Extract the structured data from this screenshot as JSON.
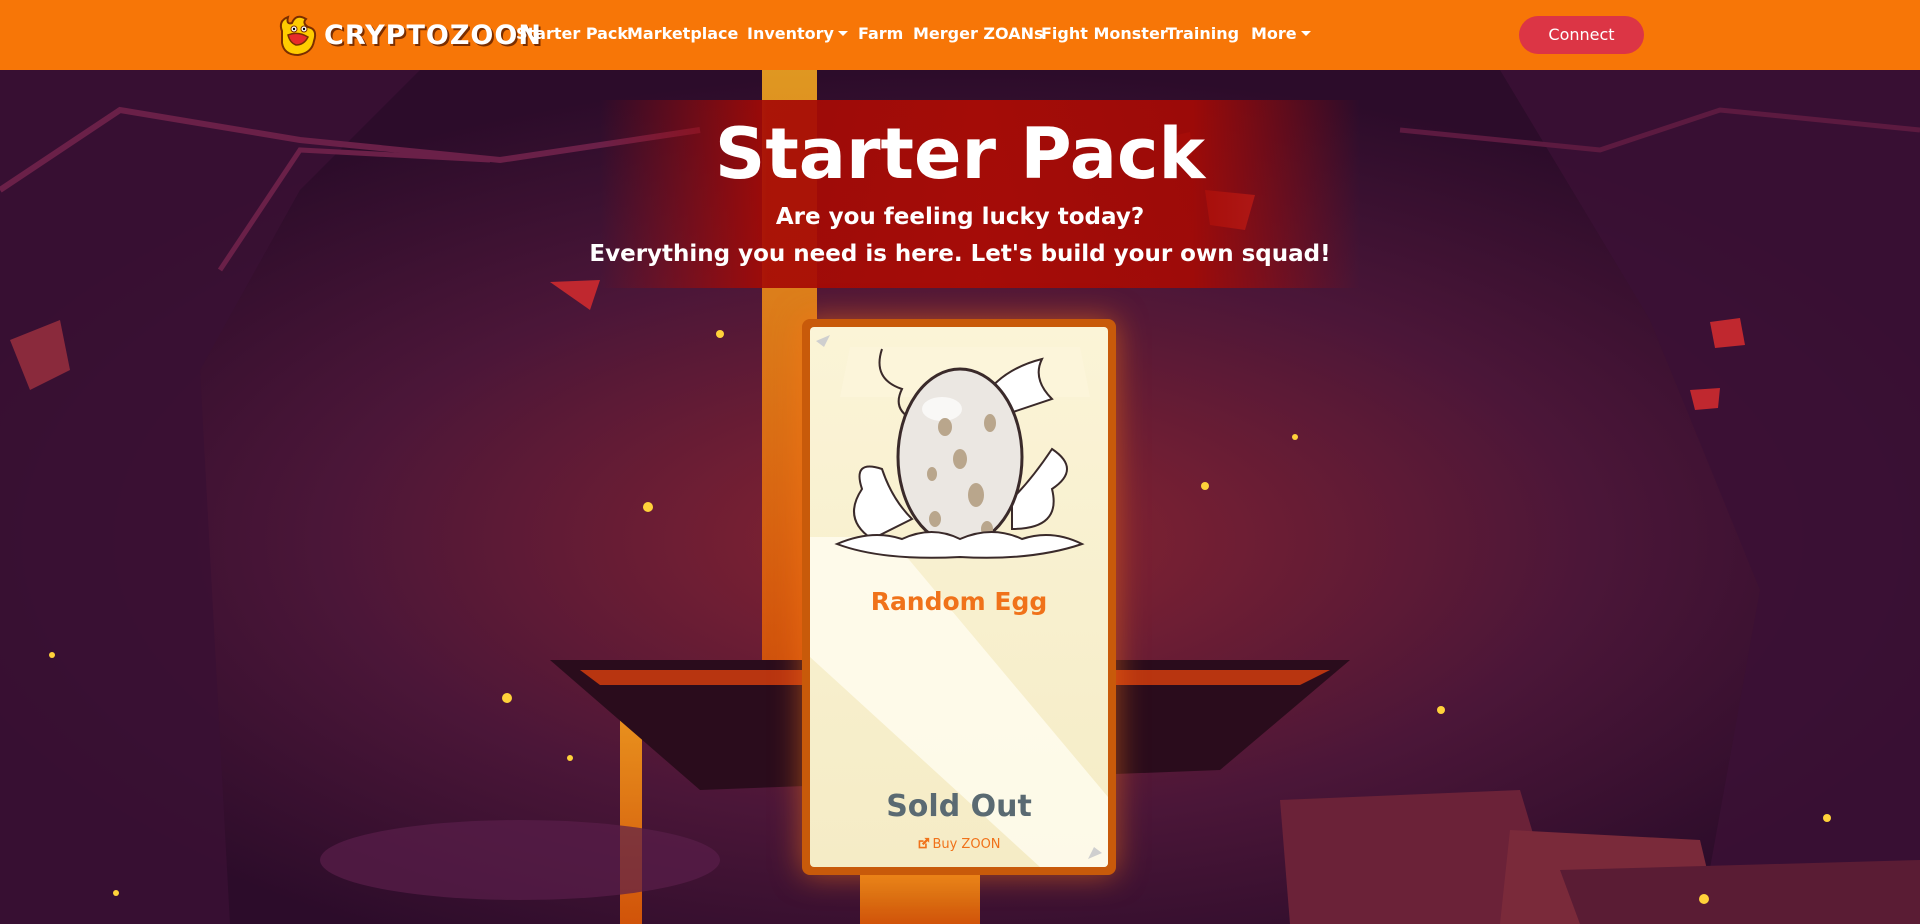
{
  "nav": {
    "brand": "CRYPTOZOON",
    "items": [
      {
        "label": "Starter Pack"
      },
      {
        "label": "Marketplace"
      },
      {
        "label": "Inventory",
        "dropdown": true
      },
      {
        "label": "Farm"
      },
      {
        "label": "Merger ZOANs"
      },
      {
        "label": "Fight Monster"
      },
      {
        "label": "Training"
      },
      {
        "label": "More",
        "dropdown": true
      }
    ],
    "connect_label": "Connect",
    "brand_color": "#f77607",
    "connect_color": "#dc3545"
  },
  "hero": {
    "title": "Starter Pack",
    "subtitle1": "Are you feeling lucky today?",
    "subtitle2": "Everything you need is here. Let's build your own squad!"
  },
  "card": {
    "title": "Random Egg",
    "status": "Sold Out",
    "buy_label": "Buy ZOON",
    "icon": "external-link-icon",
    "accent_color": "#f0721a"
  }
}
